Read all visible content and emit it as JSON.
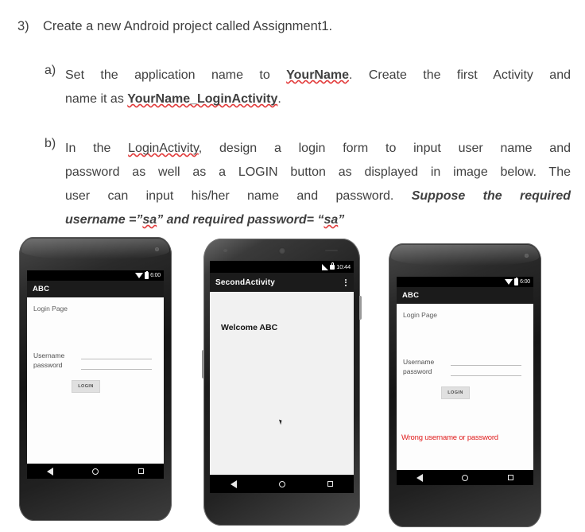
{
  "document": {
    "question_number": "3)",
    "question_text": "Create a new Android project called Assignment1.",
    "items": [
      {
        "marker": "a)",
        "part1": "Set the application name to ",
        "emph1": "YourName",
        "part2": ". Create the first Activity and",
        "part3": "name it as ",
        "emph2": "YourName_LoginActivity",
        "part4": "."
      },
      {
        "marker": "b)",
        "line1_a": "In the ",
        "line1_b": "LoginActivity",
        "line1_c": ", design a login form to input user name and",
        "line2": "password as well as a LOGIN button as displayed in image below. The",
        "line3_a": "user can input his/her name and password. ",
        "line3_b": "Suppose the required",
        "line4_a": "username =”",
        "line4_b": "sa",
        "line4_c": "” and required password= “",
        "line4_d": "sa",
        "line4_e": "”"
      }
    ]
  },
  "phones": [
    {
      "id": "phone-login",
      "statusbar": {
        "time": "6:00",
        "icons": [
          "wifi-icon",
          "battery-icon"
        ]
      },
      "actionbar": {
        "title": "ABC",
        "overflow": false
      },
      "screen": {
        "page_label": "Login Page",
        "fields": [
          {
            "label": "Username",
            "value": ""
          },
          {
            "label": "password",
            "value": ""
          }
        ],
        "button_label": "LOGIN",
        "error": ""
      },
      "navbar": {
        "back": "back-icon",
        "home": "home-icon",
        "recents": "recents-icon"
      }
    },
    {
      "id": "phone-second-activity",
      "statusbar": {
        "time": "10:44",
        "icons": [
          "signal-icon",
          "lock-icon"
        ]
      },
      "actionbar": {
        "title": "SecondActivity",
        "overflow": true
      },
      "screen": {
        "welcome": "Welcome ABC"
      },
      "navbar": {
        "back": "back-icon",
        "home": "home-icon",
        "recents": "recents-icon"
      }
    },
    {
      "id": "phone-login-error",
      "statusbar": {
        "time": "6:00",
        "icons": [
          "wifi-icon",
          "battery-icon"
        ]
      },
      "actionbar": {
        "title": "ABC",
        "overflow": false
      },
      "screen": {
        "page_label": "Login Page",
        "fields": [
          {
            "label": "Username",
            "value": ""
          },
          {
            "label": "password",
            "value": ""
          }
        ],
        "button_label": "LOGIN",
        "error": "Wrong username or password"
      },
      "navbar": {
        "back": "back-icon",
        "home": "home-icon",
        "recents": "recents-icon"
      }
    }
  ],
  "colors": {
    "error_red": "#e01b1b",
    "spellcheck_red": "#e23a3a",
    "text": "#404040",
    "actionbar_bg": "#1b1b1b"
  }
}
